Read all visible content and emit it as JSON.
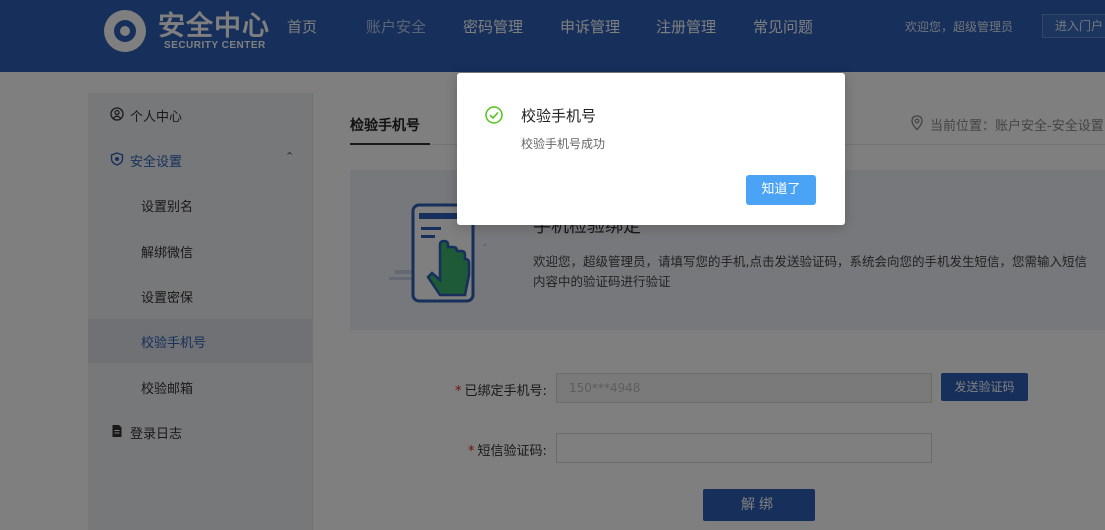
{
  "header": {
    "logo_title": "安全中心",
    "logo_subtitle": "SECURITY CENTER",
    "nav": [
      {
        "label": "首页"
      },
      {
        "label": "账户安全"
      },
      {
        "label": "密码管理"
      },
      {
        "label": "申诉管理"
      },
      {
        "label": "注册管理"
      },
      {
        "label": "常见问题"
      }
    ],
    "welcome": "欢迎您，超级管理员",
    "portal_button": "进入门户"
  },
  "sidebar": {
    "items": [
      {
        "label": "个人中心",
        "icon": "user-circle-icon"
      },
      {
        "label": "安全设置",
        "icon": "shield-icon"
      },
      {
        "label": "设置别名"
      },
      {
        "label": "解绑微信"
      },
      {
        "label": "设置密保"
      },
      {
        "label": "校验手机号"
      },
      {
        "label": "校验邮箱"
      },
      {
        "label": "登录日志",
        "icon": "document-icon"
      }
    ]
  },
  "main": {
    "title": "检验手机号",
    "breadcrumb": "当前位置：账户安全-安全设置",
    "info_heading": "手机检验绑定",
    "info_text": "欢迎您，超级管理员，请填写您的手机,点击发送验证码，系统会向您的手机发生短信，您需输入短信内容中的验证码进行验证",
    "form": {
      "phone_label": "已绑定手机号:",
      "phone_value": "150***4948",
      "send_code_button": "发送验证码",
      "code_label": "短信验证码:",
      "code_value": "",
      "submit_button": "解绑"
    }
  },
  "modal": {
    "title": "校验手机号",
    "message": "校验手机号成功",
    "ok_button": "知道了"
  },
  "colors": {
    "brand": "#2d5fb7",
    "success": "#52c41a",
    "modal_button": "#4aa3f5",
    "required": "#e2231a"
  }
}
